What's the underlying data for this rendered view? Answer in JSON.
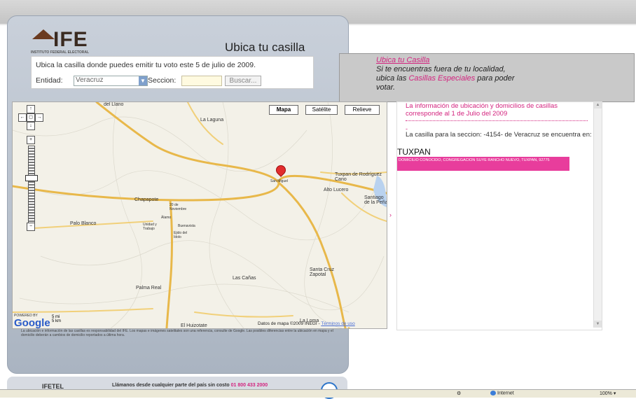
{
  "header": {
    "logo_text": "IFE",
    "logo_subtitle": "INSTITUTO FEDERAL ELECTORAL",
    "title": "Ubica tu casilla"
  },
  "form": {
    "instruction": "Ubica la casilla donde puedes emitir tu voto este 5 de julio de 2009.",
    "entidad_label": "Entidad:",
    "entidad_value": "Veracruz",
    "seccion_label": "Seccion:",
    "seccion_value": "",
    "buscar_label": "Buscar..."
  },
  "info": {
    "link": "Ubica tu Casilla",
    "text_1": "Si te encuentras fuera de tu localidad, ubica las ",
    "link_2": "Casillas Especiales",
    "text_2": " para poder votar."
  },
  "map": {
    "types": [
      "Mapa",
      "Satélite",
      "Relieve"
    ],
    "labels": {
      "el_llano": "del Llano",
      "la_laguna": "La Laguna",
      "tuxpan": "Tuxpan de Rodríguez Cano",
      "alto_lucero": "Alto Lucero",
      "san_miguel": "San Miguel",
      "santiago": "Santiago de la Peña",
      "chapapote": "Chapapote",
      "noviembre": "20 de Noviembre",
      "alamo": "Álamo",
      "unidad": "Unidad y Trabajo",
      "buenavista": "Buenavista",
      "ejido": "Ejido del Ídolo",
      "palo_blanco": "Palo Blanco",
      "las_canas": "Las Cañas",
      "santa_cruz": "Santa Cruz Zapotal",
      "palma_real": "Palma Real",
      "huizotate": "El Huizotate",
      "la_loma": "La Loma"
    },
    "google": "Google",
    "powered": "POWERED BY",
    "scale_mi": "5 mi",
    "scale_km": "5 km",
    "footer_text": "Datos de mapa ©2009 INEGI -",
    "footer_link": "Términos de uso"
  },
  "disclaimer": "La ubicación e información de las casillas es responsabilidad del IFE. Los mapas e imágenes satelitales son una referencia, consulte de Google. Las posibles diferencias entre la ubicación en mapa y el domicilio deberán a cambios de domicilio reportados a última hora.",
  "results": {
    "header": "La información de ubicación y domicilios de casillas corresponde al 1 de Julio del 2009",
    "dash": "-",
    "line": "La casilla para la seccion: -4154- de Veracruz se encuentra en:",
    "city": "TUXPAN",
    "address": "DOMICILIO CONOCIDO, CONGREGACION SUYE RANCHO NUEVO, TUXPAN, 92775"
  },
  "footer_bar": {
    "logo": "IFETEL",
    "text": "Llámanos desde cualquier parte del país sin costo",
    "tel": "01 800 433 2000"
  },
  "statusbar": {
    "zone": "Internet",
    "zoom": "100%"
  },
  "colors": {
    "accent_pink": "#d3237e",
    "road": "#e8b84a",
    "panel": "#b7c0cc"
  }
}
